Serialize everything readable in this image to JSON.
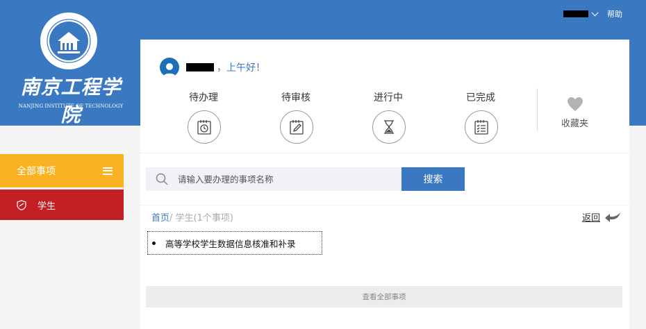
{
  "header": {
    "help_label": "帮助"
  },
  "logo": {
    "school_name_cn": "南京工程学院",
    "school_name_en": "NANJING INSTITUTE OF TECHNOLOGY",
    "seal_text": "南京工程学院"
  },
  "sidebar": {
    "all_items_label": "全部事项",
    "student_label": "学生"
  },
  "greeting": {
    "text": "，上午好！"
  },
  "stats": [
    {
      "label": "待办理",
      "icon": "clock-calendar-icon"
    },
    {
      "label": "待审核",
      "icon": "pen-calendar-icon"
    },
    {
      "label": "进行中",
      "icon": "hourglass-icon"
    },
    {
      "label": "已完成",
      "icon": "checklist-icon"
    }
  ],
  "favorites": {
    "label": "收藏夹",
    "icon": "heart-icon"
  },
  "search": {
    "placeholder": "请输入要办理的事项名称",
    "button_label": "搜索"
  },
  "breadcrumb": {
    "home": "首页",
    "current": "/ 学生(1个事项)",
    "back_label": "返回"
  },
  "items": [
    {
      "title": "高等学校学生数据信息核准和补录"
    }
  ],
  "view_all_label": "查看全部事项",
  "colors": {
    "brand_blue": "#3a78c2",
    "nav_yellow": "#f9b322",
    "nav_red": "#c41f24"
  }
}
